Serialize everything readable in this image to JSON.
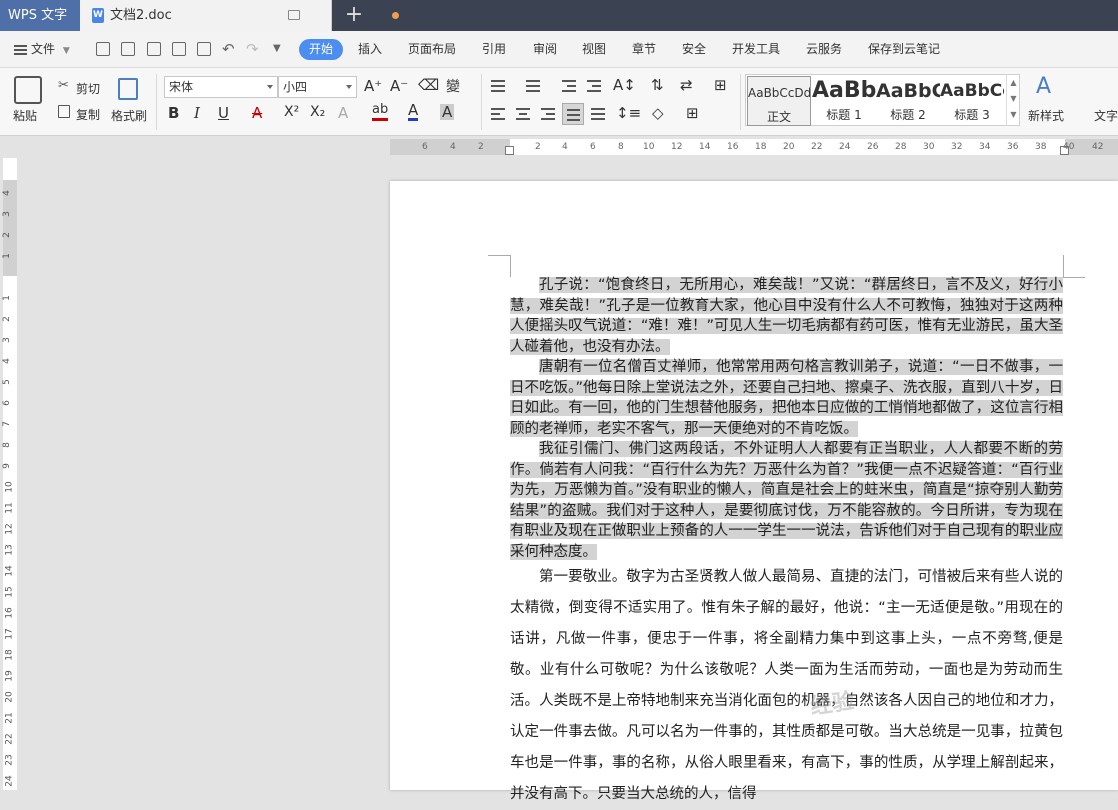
{
  "titlebar": {
    "app_name": "WPS 文字",
    "doc_tab": "文档2.doc",
    "new_tab": "+"
  },
  "menu": {
    "file": "文件",
    "tabs": [
      "开始",
      "插入",
      "页面布局",
      "引用",
      "审阅",
      "视图",
      "章节",
      "安全",
      "开发工具",
      "云服务",
      "保存到云笔记"
    ]
  },
  "ribbon": {
    "paste": "粘贴",
    "cut": "剪切",
    "copy": "复制",
    "format_painter": "格式刷",
    "font_name": "宋体",
    "font_size": "小四",
    "bold": "B",
    "italic": "I",
    "underline": "U",
    "strike": "A",
    "superscript": "X²",
    "subscript": "X₂",
    "grow_font": "A⁺",
    "shrink_font": "A⁻",
    "styles": [
      {
        "preview": "AaBbCcDd",
        "label": "正文"
      },
      {
        "preview": "AaBb",
        "label": "标题 1"
      },
      {
        "preview": "AaBbC",
        "label": "标题 2"
      },
      {
        "preview": "AaBbCc",
        "label": "标题 3"
      }
    ],
    "new_style": "新样式",
    "text_tools": "文字"
  },
  "ruler": {
    "h_numbers": [
      "6",
      "4",
      "2",
      "2",
      "4",
      "6",
      "8",
      "10",
      "12",
      "14",
      "16",
      "18",
      "20",
      "22",
      "24",
      "26",
      "28",
      "30",
      "32",
      "34",
      "36",
      "38",
      "40",
      "42"
    ],
    "v_numbers": [
      "4",
      "3",
      "2",
      "1",
      "1",
      "2",
      "3",
      "4",
      "5",
      "6",
      "7",
      "8",
      "9",
      "10",
      "11",
      "12",
      "13",
      "14",
      "15",
      "16",
      "17",
      "18",
      "19",
      "20",
      "21",
      "22",
      "23",
      "24"
    ]
  },
  "document": {
    "selected_paragraphs": [
      "孔子说：“饱食终日，无所用心，难矣哉！”又说：“群居终日，言不及义，好行小慧，难矣哉！”孔子是一位教育大家，他心目中没有什么人不可教悔，独独对于这两种人便摇头叹气说道：“难！难！”可见人生一切毛病都有药可医，惟有无业游民，虽大圣人碰着他，也没有办法。",
      "唐朝有一位名僧百丈禅师，他常常用两句格言教训弟子，说道：“一日不做事，一日不吃饭。”他每日除上堂说法之外，还要自己扫地、擦桌子、洗衣服，直到八十岁，日日如此。有一回，他的门生想替他服务，把他本日应做的工悄悄地都做了，这位言行相顾的老禅师，老实不客气，那一天便绝对的不肯吃饭。",
      "我征引儒门、佛门这两段话，不外证明人人都要有正当职业，人人都要不断的劳作。倘若有人问我：“百行什么为先？万恶什么为首？”我便一点不迟疑答道：“百行业为先，万恶懒为首。”没有职业的懒人，简直是社会上的蛀米虫，简直是“掠夺别人勤劳结果”的盗贼。我们对于这种人，是要彻底讨伐，万不能容赦的。今日所讲，专为现在有职业及现在正做职业上预备的人一一学生一一说法，告诉他们对于自己现有的职业应采何种态度。"
    ],
    "plain_paragraph": "第一要敬业。敬字为古圣贤教人做人最简易、直捷的法门，可惜被后来有些人说的太精微，倒变得不适实用了。惟有朱子解的最好，他说：“主一无适便是敬。”用现在的话讲，凡做一件事，便忠于一件事，将全副精力集中到这事上头，一点不旁骛,便是敬。业有什么可敬呢？为什么该敬呢？人类一面为生活而劳动，一面也是为劳动而生活。人类既不是上帝特地制来充当消化面包的机器，自然该各人因自己的地位和才力，认定一件事去做。凡可以名为一件事的，其性质都是可敬。当大总统是一见事，拉黄包车也是一件事，事的名称，从俗人眼里看来，有高下，事的性质，从学理上解剖起来，并没有高下。只要当大总统的人，信得"
  },
  "watermark": "经验",
  "colors": {
    "titlebar": "#3b4352",
    "accent": "#4c8df0",
    "selection": "#d3d3d3"
  }
}
